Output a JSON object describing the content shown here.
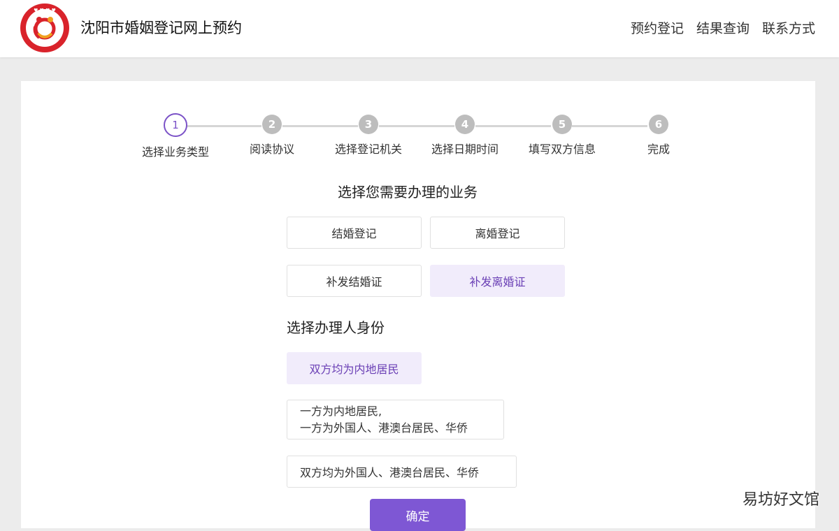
{
  "header": {
    "logo_text": "婚姻登记",
    "title": "沈阳市婚姻登记网上预约",
    "nav": [
      "预约登记",
      "结果查询",
      "联系方式"
    ]
  },
  "steps": [
    {
      "num": "1",
      "label": "选择业务类型",
      "active": true
    },
    {
      "num": "2",
      "label": "阅读协议",
      "active": false
    },
    {
      "num": "3",
      "label": "选择登记机关",
      "active": false
    },
    {
      "num": "4",
      "label": "选择日期时间",
      "active": false
    },
    {
      "num": "5",
      "label": "填写双方信息",
      "active": false
    },
    {
      "num": "6",
      "label": "完成",
      "active": false
    }
  ],
  "business": {
    "title": "选择您需要办理的业务",
    "options": [
      "结婚登记",
      "离婚登记",
      "补发结婚证",
      "补发离婚证"
    ],
    "selected": "补发离婚证"
  },
  "identity": {
    "title": "选择办理人身份",
    "options": [
      {
        "line1": "双方均为内地居民",
        "line2": ""
      },
      {
        "line1": "一方为内地居民,",
        "line2": "一方为外国人、港澳台居民、华侨"
      },
      {
        "line1": "双方均为外国人、港澳台居民、华侨",
        "line2": ""
      }
    ],
    "selected": "双方均为内地居民"
  },
  "confirm_label": "确定",
  "watermark": "易坊好文馆",
  "colors": {
    "accent": "#7e57d4",
    "selected_bg": "#f1ecfb",
    "logo_red": "#d9232b"
  }
}
